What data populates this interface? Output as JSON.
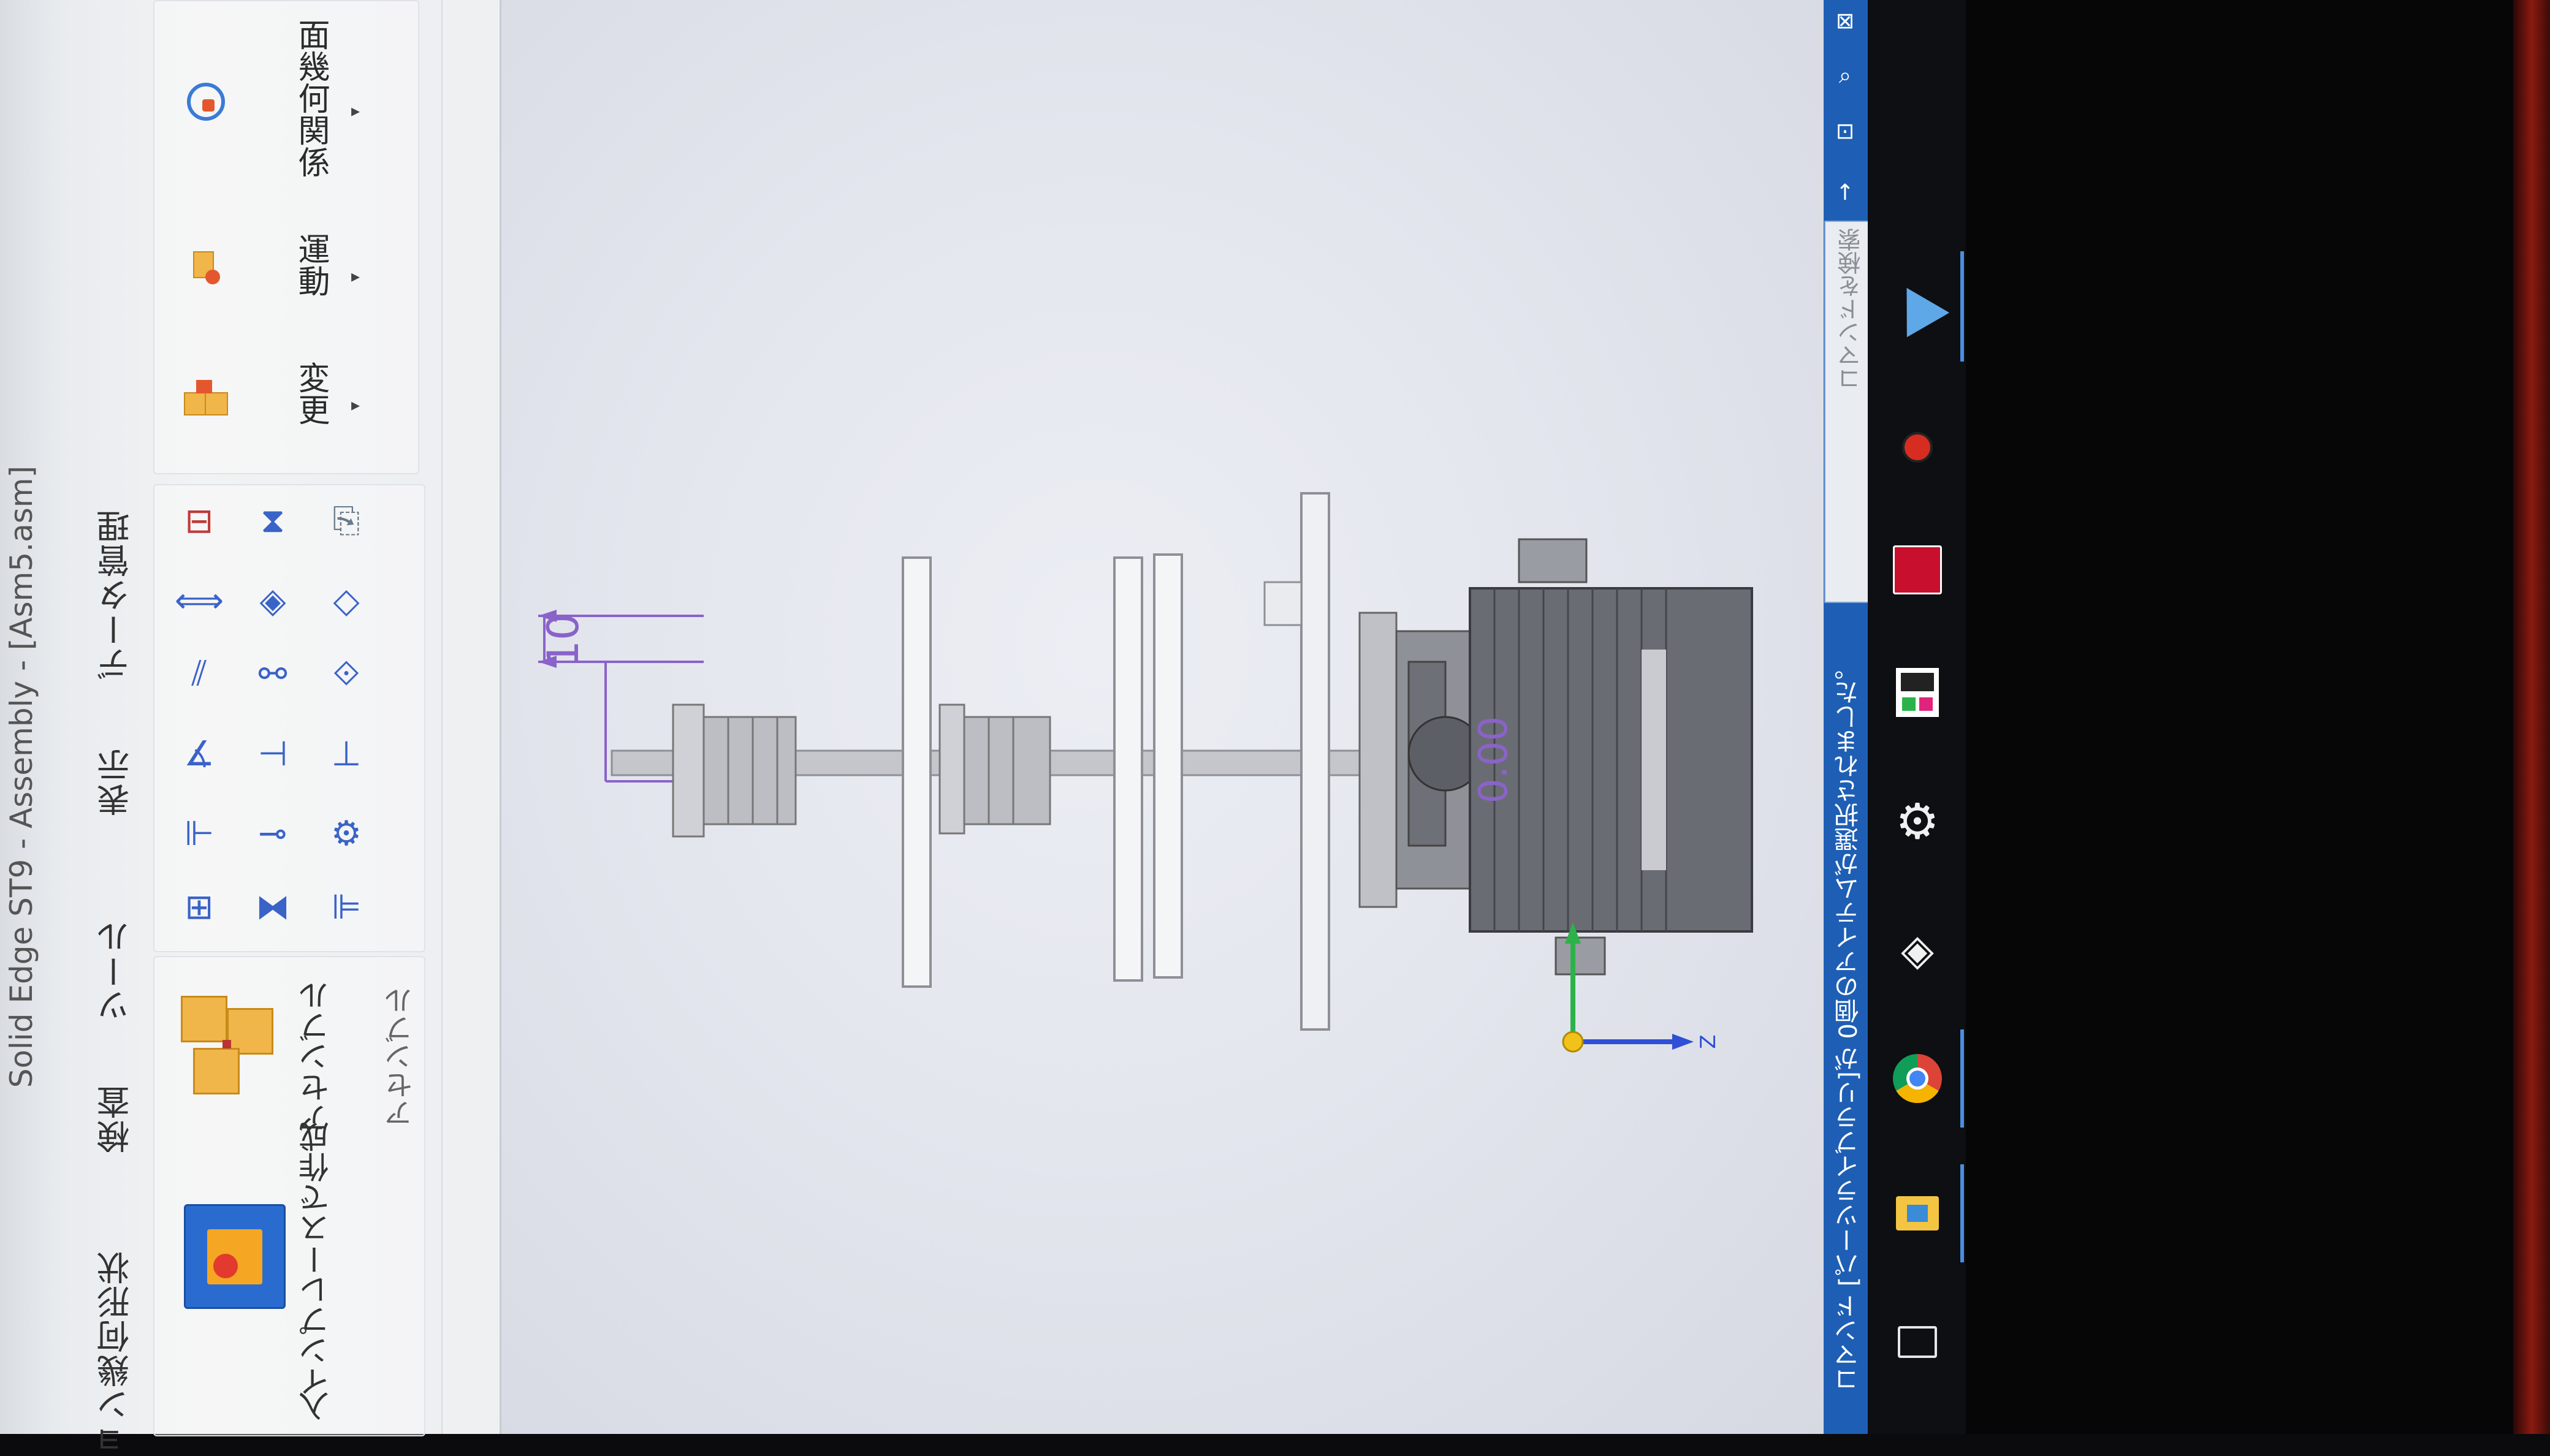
{
  "window": {
    "title": "Solid Edge ST9 - Assembly - [Asm5.asm]"
  },
  "tabs": [
    {
      "label": "ョン幾何形状"
    },
    {
      "label": "検査"
    },
    {
      "label": "ツール"
    },
    {
      "label": "表示"
    },
    {
      "label": "データ管理"
    }
  ],
  "ribbon": {
    "place_label": "入",
    "create_inplace_label": "インプレースで作成",
    "assemble_label": "アセンブル",
    "group_label": "アセンブル",
    "modify_label": "変更",
    "motion_label": "運動",
    "face_relate_label": "面幾何関係"
  },
  "canvas": {
    "dimension_value": "10",
    "center_label": "0.00",
    "axis_z_label": "Z"
  },
  "statusbar": {
    "message": "コマンド [パーツライブラリ]が 0個のアイテムが選択されました。",
    "command_placeholder": "コマンドを検索"
  },
  "colors": {
    "status_blue": "#1e5fb5",
    "dimension_purple": "#8a63c9",
    "axis_green": "#2db24a",
    "axis_blue": "#2e4fd6",
    "axis_yellow": "#f2c21a"
  },
  "taskbar": {
    "icons": [
      "task-view-icon",
      "file-explorer-icon",
      "chrome-icon",
      "fox-app-icon",
      "settings-gear-icon",
      "proxy-app-icon",
      "cs-eagle-app-icon",
      "ladybug-app-icon",
      "bird-app-icon"
    ]
  }
}
